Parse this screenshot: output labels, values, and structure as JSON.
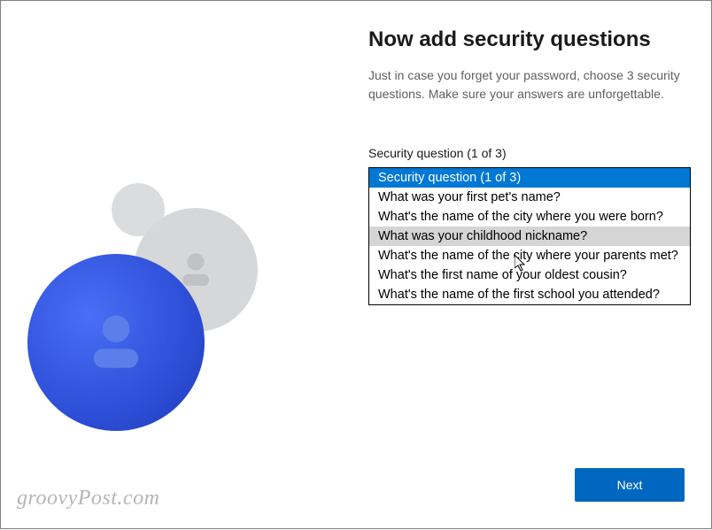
{
  "header": {
    "title": "Now add security questions",
    "subtitle": "Just in case you forget your password, choose 3 security questions. Make sure your answers are unforgettable."
  },
  "field": {
    "label": "Security question (1 of 3)"
  },
  "dropdown": {
    "options": [
      "Security question (1 of 3)",
      "What was your first pet's name?",
      "What's the name of the city where you were born?",
      "What was your childhood nickname?",
      "What's the name of the city where your parents met?",
      "What's the first name of your oldest cousin?",
      "What's the name of the first school you attended?"
    ],
    "selectedIndex": 0,
    "hoverIndex": 3
  },
  "buttons": {
    "next": "Next"
  },
  "watermark": "groovyPost.com"
}
